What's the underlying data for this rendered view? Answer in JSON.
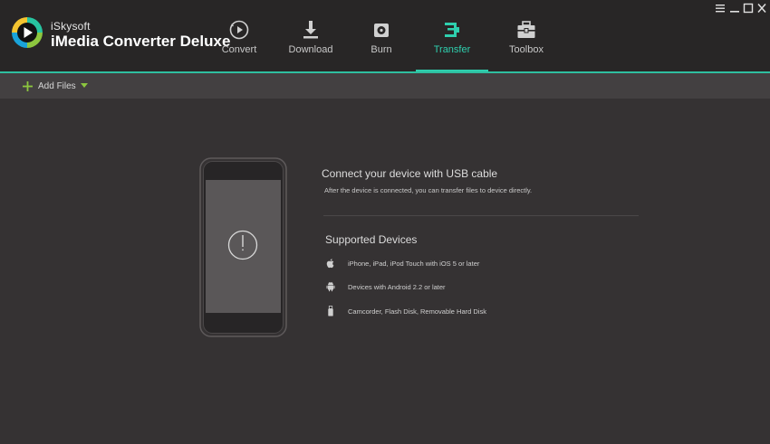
{
  "app": {
    "brand_small": "iSkysoft",
    "brand_name": "iMedia Converter Deluxe"
  },
  "tabs": [
    {
      "label": "Convert",
      "icon": "convert-icon"
    },
    {
      "label": "Download",
      "icon": "download-icon"
    },
    {
      "label": "Burn",
      "icon": "burn-icon"
    },
    {
      "label": "Transfer",
      "icon": "transfer-icon",
      "active": true
    },
    {
      "label": "Toolbox",
      "icon": "toolbox-icon"
    }
  ],
  "window_controls": [
    "menu-icon",
    "minimize-icon",
    "maximize-icon",
    "close-icon"
  ],
  "toolbar": {
    "add_files_label": "Add Files"
  },
  "content": {
    "connect_title": "Connect your device with USB cable",
    "connect_subtitle": "After the device is connected, you can transfer files to device directly.",
    "supported_title": "Supported Devices",
    "devices": [
      {
        "icon": "apple-icon",
        "text": "iPhone, iPad, iPod Touch with iOS 5 or later"
      },
      {
        "icon": "android-icon",
        "text": "Devices with Android 2.2 or later"
      },
      {
        "icon": "usb-drive-icon",
        "text": "Camcorder, Flash Disk, Removable Hard Disk"
      }
    ]
  },
  "colors": {
    "accent": "#2fcfae",
    "header_bg": "#282626",
    "toolbar_bg": "#434041",
    "content_bg": "#353233",
    "add_icon": "#8cc63f"
  }
}
